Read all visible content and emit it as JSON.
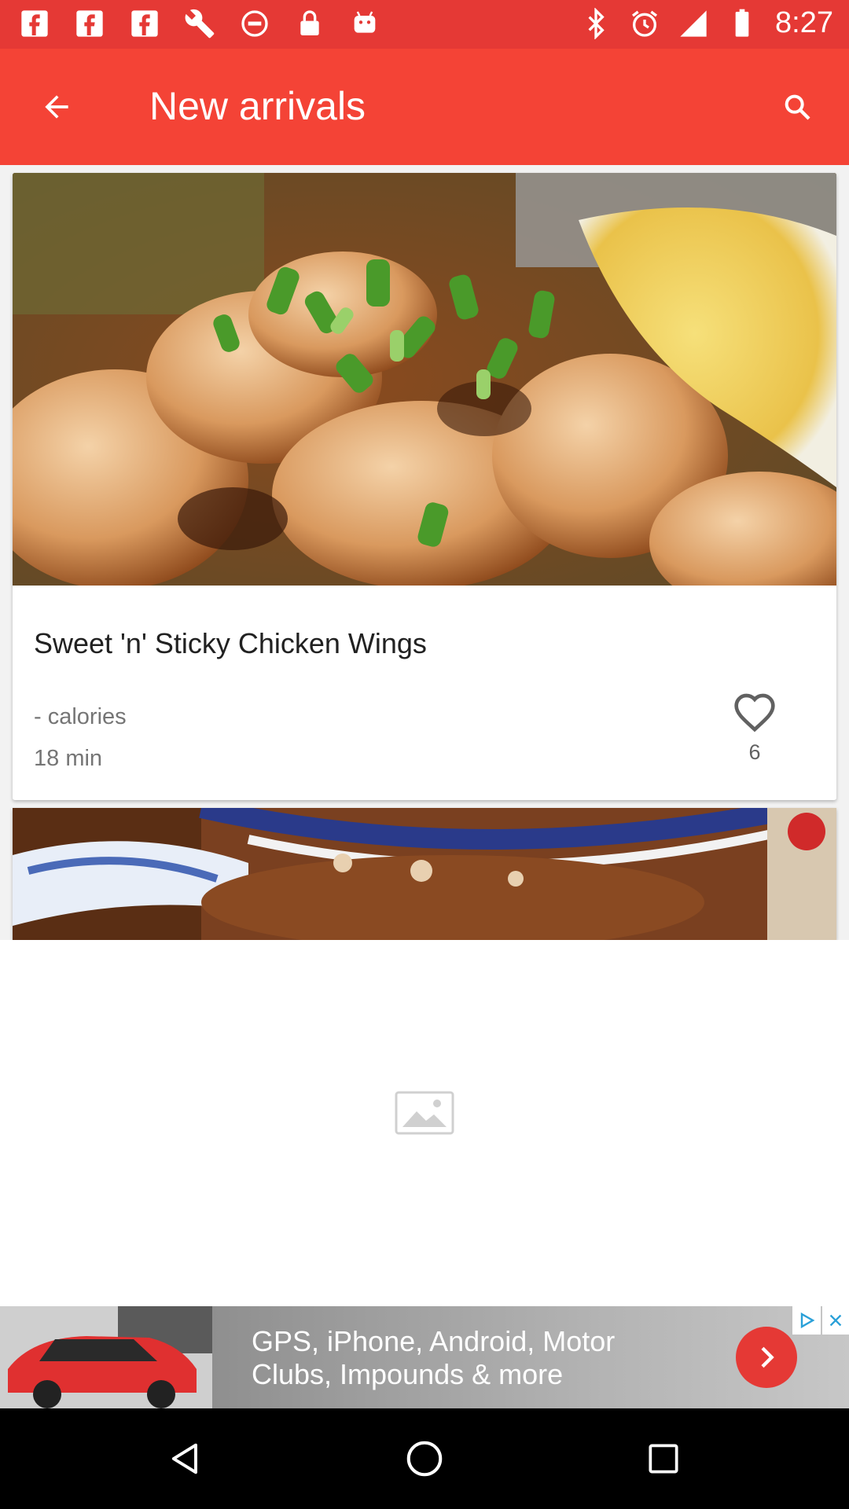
{
  "status_bar": {
    "time": "8:27",
    "left_icons": [
      "facebook-icon",
      "facebook-icon",
      "facebook-icon",
      "wrench-icon",
      "no-entry-icon",
      "lock-icon",
      "android-icon"
    ],
    "right_icons": [
      "bluetooth-icon",
      "alarm-icon",
      "signal-icon",
      "battery-icon"
    ],
    "color": "#e53935"
  },
  "app_bar": {
    "title": "New arrivals",
    "back_icon": "arrow-back-icon",
    "search_icon": "search-icon",
    "color": "#f44336"
  },
  "recipes": [
    {
      "title": "Sweet 'n' Sticky Chicken Wings",
      "calories": "- calories",
      "time": "18 min",
      "likes": "6",
      "like_icon": "heart-outline-icon"
    }
  ],
  "ad": {
    "text_line1": "GPS, iPhone, Android, Motor",
    "text_line2": "Clubs, Impounds & more",
    "arrow_icon": "chevron-right-icon",
    "choices_icon": "ad-choices-icon",
    "close_icon": "close-icon",
    "accent": "#e53935"
  },
  "nav_bar": {
    "back_icon": "nav-back-icon",
    "home_icon": "nav-home-icon",
    "recents_icon": "nav-recents-icon"
  }
}
